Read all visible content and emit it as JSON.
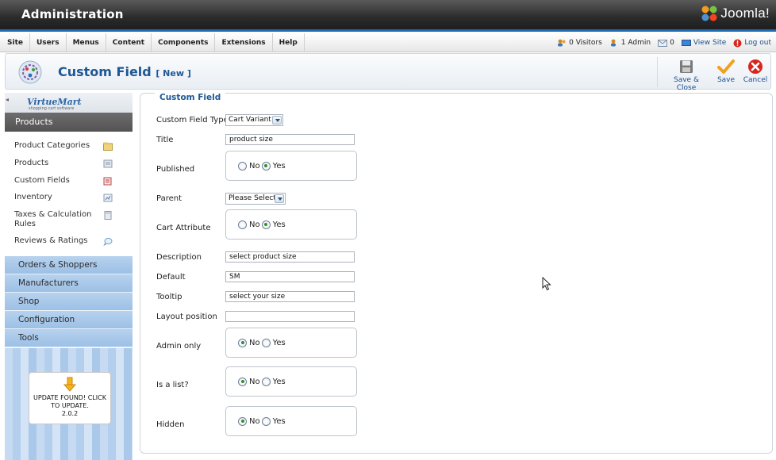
{
  "header": {
    "title": "Administration",
    "brand": "Joomla!"
  },
  "menubar": {
    "items": [
      "Site",
      "Users",
      "Menus",
      "Content",
      "Components",
      "Extensions",
      "Help"
    ],
    "status": {
      "visitors": "0 Visitors",
      "admins": "1 Admin",
      "messages": "0",
      "view_site": "View Site",
      "logout": "Log out"
    }
  },
  "toolbar": {
    "title": "Custom Field",
    "subtitle": "[ New ]",
    "buttons": {
      "save_close": "Save & Close",
      "save": "Save",
      "cancel": "Cancel"
    }
  },
  "sidebar": {
    "logo": "VirtueMart",
    "logo_tag": "shopping cart software",
    "active_section": "Products",
    "product_items": [
      "Product Categories",
      "Products",
      "Custom Fields",
      "Inventory",
      "Taxes & Calculation Rules",
      "Reviews & Ratings"
    ],
    "sections": [
      "Orders & Shoppers",
      "Manufacturers",
      "Shop",
      "Configuration",
      "Tools"
    ],
    "update": {
      "text": "UPDATE FOUND! CLICK TO UPDATE.",
      "version": "2.0.2"
    }
  },
  "form": {
    "legend": "Custom Field",
    "custom_field_type": {
      "label": "Custom Field Type:",
      "value": "Cart Variant"
    },
    "title": {
      "label": "Title",
      "value": "product size"
    },
    "published": {
      "label": "Published",
      "no": "No",
      "yes": "Yes",
      "selected": "Yes"
    },
    "parent": {
      "label": "Parent",
      "value": "Please Select"
    },
    "cart_attribute": {
      "label": "Cart Attribute",
      "no": "No",
      "yes": "Yes",
      "selected": "Yes"
    },
    "description": {
      "label": "Description",
      "value": "select product size"
    },
    "default": {
      "label": "Default",
      "value": "SM"
    },
    "tooltip": {
      "label": "Tooltip",
      "value": "select your size"
    },
    "layout_position": {
      "label": "Layout position",
      "value": ""
    },
    "admin_only": {
      "label": "Admin only",
      "no": "No",
      "yes": "Yes",
      "selected": "No"
    },
    "is_list": {
      "label": "Is a list?",
      "no": "No",
      "yes": "Yes",
      "selected": "No"
    },
    "hidden": {
      "label": "Hidden",
      "no": "No",
      "yes": "Yes",
      "selected": "No"
    }
  },
  "colors": {
    "accent_blue": "#1d5896",
    "header_dark": "#2b2b2b",
    "sidebar_blue": "#a9c8ea",
    "save_orange": "#f0a11e",
    "cancel_red": "#d9261c"
  }
}
